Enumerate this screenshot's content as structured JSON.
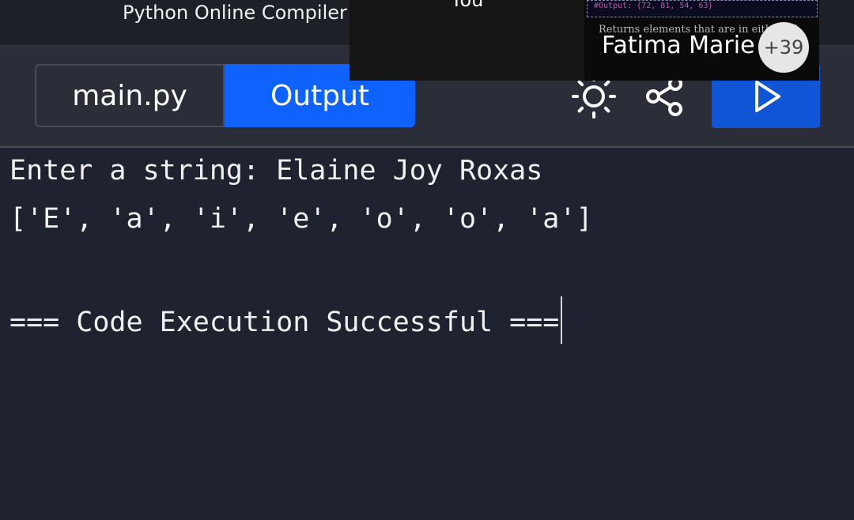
{
  "app": {
    "title": "Python Online Compiler"
  },
  "tabs": {
    "main_label": "main.py",
    "output_label": "Output"
  },
  "toolbar": {
    "theme_icon": "sun-icon",
    "share_icon": "share-icon",
    "run_icon": "play-icon"
  },
  "output": {
    "lines": [
      "Enter a string: Elaine Joy Roxas",
      "['E', 'a', 'i', 'e', 'o', 'o', 'a']",
      "",
      "=== Code Execution Successful ==="
    ]
  },
  "overlay": {
    "self_label": "You",
    "snippet_code": "#Output: {72, 81, 54, 63}",
    "snippet_text": "Returns elements that are in either of",
    "participant_name": "Fatima Marie",
    "participant_count": "+39"
  },
  "colors": {
    "background": "#1f2330",
    "accent": "#0f62fe",
    "run_button": "#0f55d6"
  }
}
